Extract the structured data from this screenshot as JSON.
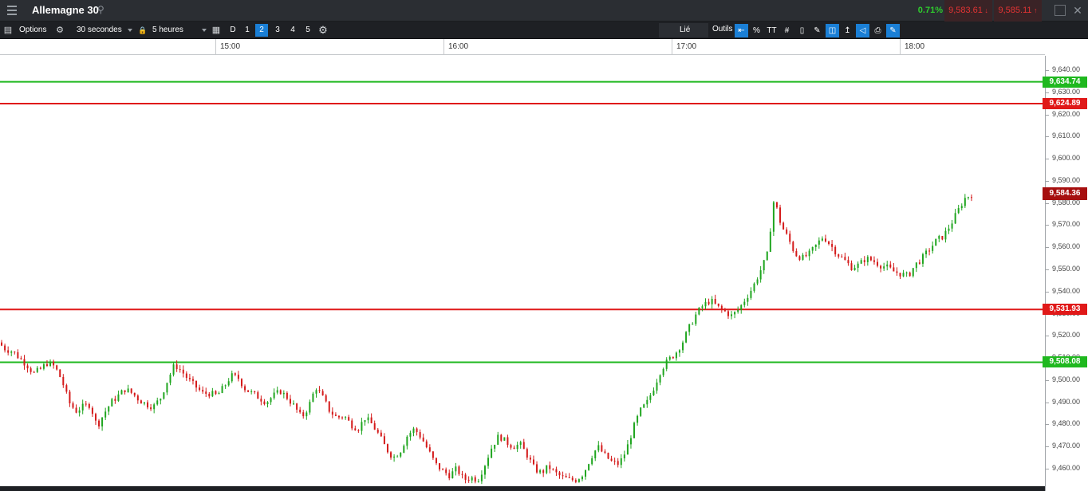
{
  "title_bar": {
    "menu_icon": "hamburger-icon",
    "instrument": "Allemagne 30",
    "search_icon": "search-icon",
    "change_percent": "0.71%",
    "sell_price": "9,583.61",
    "buy_price": "9,585.11",
    "change_color": "#2ecc2e",
    "price_color": "#e23333"
  },
  "toolbar": {
    "options_label": "Options",
    "interval": "30 secondes",
    "range": "5 heures",
    "d_label": "D",
    "layouts": [
      "1",
      "2",
      "3",
      "4",
      "5"
    ],
    "active_layout": "2",
    "linked_label": "Lié",
    "tools_label": "Outils",
    "percent_label": "%",
    "text_tool_label": "TT",
    "accent_color": "#1a7fd6"
  },
  "chart_data": {
    "type": "candlestick",
    "time_labels": [
      "15:00",
      "16:00",
      "17:00",
      "18:00"
    ],
    "ylim": [
      9455,
      9645
    ],
    "yticks": [
      9640,
      9630,
      9620,
      9610,
      9600,
      9590,
      9580,
      9570,
      9560,
      9550,
      9540,
      9530,
      9520,
      9510,
      9500,
      9490,
      9480,
      9470,
      9460
    ],
    "ytick_labels": [
      "9,640.00",
      "9,630.00",
      "9,620.00",
      "9,610.00",
      "9,600.00",
      "9,590.00",
      "9,580.00",
      "9,570.00",
      "9,560.00",
      "9,550.00",
      "9,540.00",
      "9,530.00",
      "9,520.00",
      "9,510.00",
      "9,500.00",
      "9,490.00",
      "9,480.00",
      "9,470.00",
      "9,460.00"
    ],
    "levels": [
      {
        "value": 9634.74,
        "label": "9,634.74",
        "color": "#1fb81f"
      },
      {
        "value": 9624.89,
        "label": "9,624.89",
        "color": "#e01919"
      },
      {
        "value": 9531.93,
        "label": "9,531.93",
        "color": "#e01919"
      },
      {
        "value": 9508.08,
        "label": "9,508.08",
        "color": "#1fb81f"
      }
    ],
    "current_price": {
      "value": 9584.36,
      "label": "9,584.36",
      "color": "#a60f0f"
    },
    "price_path": [
      9517,
      9514,
      9513,
      9510,
      9507,
      9503,
      9505,
      9508,
      9506,
      9500,
      9490,
      9486,
      9488,
      9489,
      9479,
      9485,
      9490,
      9493,
      9496,
      9494,
      9491,
      9489,
      9488,
      9492,
      9500,
      9507,
      9504,
      9500,
      9497,
      9494,
      9494,
      9493,
      9497,
      9502,
      9501,
      9496,
      9494,
      9492,
      9490,
      9493,
      9495,
      9492,
      9488,
      9483,
      9488,
      9497,
      9492,
      9486,
      9483,
      9484,
      9480,
      9478,
      9483,
      9480,
      9475,
      9469,
      9465,
      9468,
      9475,
      9478,
      9474,
      9468,
      9462,
      9459,
      9457,
      9460,
      9455,
      9456,
      9455,
      9462,
      9470,
      9475,
      9472,
      9470,
      9471,
      9466,
      9460,
      9458,
      9461,
      9458,
      9456,
      9455,
      9455,
      9458,
      9465,
      9470,
      9466,
      9463,
      9462,
      9468,
      9478,
      9486,
      9490,
      9497,
      9505,
      9509,
      9512,
      9517,
      9524,
      9530,
      9534,
      9536,
      9533,
      9531,
      9529,
      9532,
      9537,
      9542,
      9549,
      9556,
      9582,
      9570,
      9564,
      9557,
      9555,
      9557,
      9561,
      9565,
      9561,
      9557,
      9554,
      9551,
      9552,
      9555,
      9554,
      9552,
      9551,
      9549,
      9548,
      9547,
      9552,
      9555,
      9559,
      9563,
      9565,
      9570,
      9576,
      9582,
      9584
    ]
  }
}
